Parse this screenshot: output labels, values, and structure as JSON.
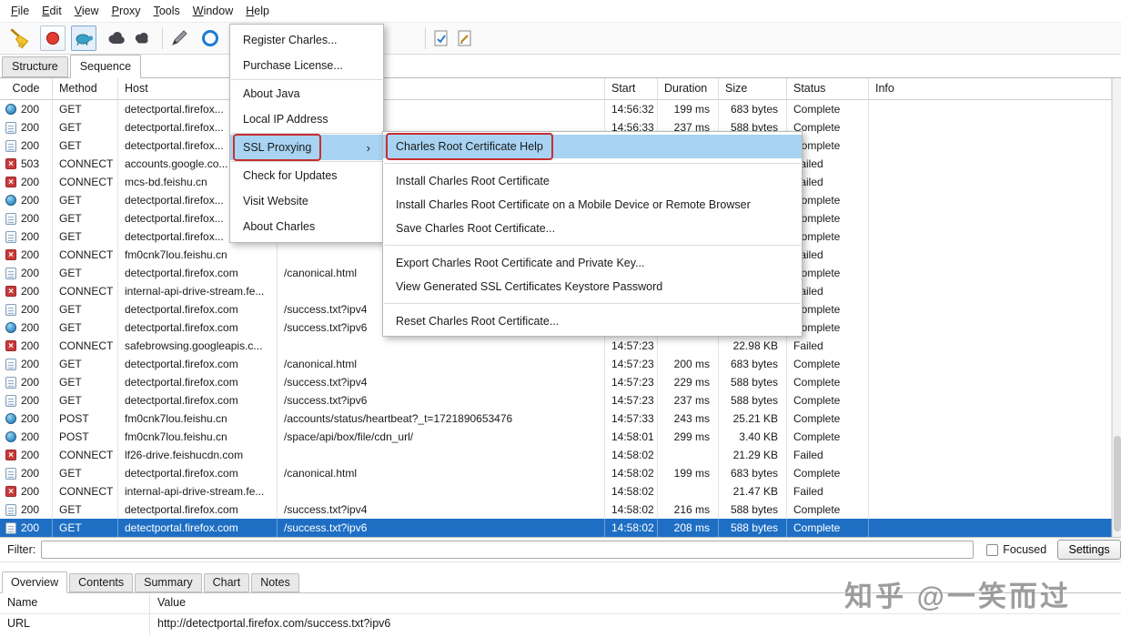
{
  "menubar": {
    "items": [
      {
        "name": "menubar-item-file",
        "label": "File"
      },
      {
        "name": "menubar-item-edit",
        "label": "Edit"
      },
      {
        "name": "menubar-item-view",
        "label": "View"
      },
      {
        "name": "menubar-item-proxy",
        "label": "Proxy"
      },
      {
        "name": "menubar-item-tools",
        "label": "Tools"
      },
      {
        "name": "menubar-item-window",
        "label": "Window"
      },
      {
        "name": "menubar-item-help",
        "label": "Help"
      }
    ]
  },
  "toolbar": {
    "icons": [
      "clear-broom-icon",
      "record-button",
      "throttle-turtle-button",
      "breakpoints-icon",
      "cloud-icon",
      "compose-pencil-icon",
      "repeat-circle-icon",
      "validate-check-icon",
      "edit-document-icon"
    ]
  },
  "view_tabs": {
    "items": [
      {
        "label": "Structure",
        "active": false
      },
      {
        "label": "Sequence",
        "active": true
      }
    ]
  },
  "table": {
    "columns": [
      "Code",
      "Method",
      "Host",
      "",
      "Start",
      "Duration",
      "Size",
      "Status",
      "Info"
    ],
    "rows": [
      {
        "icon": "orb",
        "code": "200",
        "method": "GET",
        "host": "detectportal.firefox...",
        "path": "",
        "start": "14:56:32",
        "duration": "199 ms",
        "size": "683 bytes",
        "status": "Complete",
        "info": ""
      },
      {
        "icon": "doc",
        "code": "200",
        "method": "GET",
        "host": "detectportal.firefox...",
        "path": "",
        "start": "14:56:33",
        "duration": "237 ms",
        "size": "588 bytes",
        "status": "Complete",
        "info": ""
      },
      {
        "icon": "doc",
        "code": "200",
        "method": "GET",
        "host": "detectportal.firefox...",
        "path": "",
        "start": "",
        "duration": "",
        "size": "",
        "status": "Complete",
        "info": ""
      },
      {
        "icon": "fail",
        "code": "503",
        "method": "CONNECT",
        "host": "accounts.google.co...",
        "path": "",
        "start": "",
        "duration": "",
        "size": "",
        "status": "Failed",
        "info": ""
      },
      {
        "icon": "fail",
        "code": "200",
        "method": "CONNECT",
        "host": "mcs-bd.feishu.cn",
        "path": "",
        "start": "",
        "duration": "",
        "size": "",
        "status": "Failed",
        "info": ""
      },
      {
        "icon": "orb",
        "code": "200",
        "method": "GET",
        "host": "detectportal.firefox...",
        "path": "",
        "start": "",
        "duration": "",
        "size": "",
        "status": "Complete",
        "info": ""
      },
      {
        "icon": "doc",
        "code": "200",
        "method": "GET",
        "host": "detectportal.firefox...",
        "path": "",
        "start": "",
        "duration": "",
        "size": "",
        "status": "Complete",
        "info": ""
      },
      {
        "icon": "doc",
        "code": "200",
        "method": "GET",
        "host": "detectportal.firefox...",
        "path": "",
        "start": "",
        "duration": "",
        "size": "",
        "status": "Complete",
        "info": ""
      },
      {
        "icon": "fail",
        "code": "200",
        "method": "CONNECT",
        "host": "fm0cnk7lou.feishu.cn",
        "path": "",
        "start": "",
        "duration": "",
        "size": "",
        "status": "Failed",
        "info": ""
      },
      {
        "icon": "doc",
        "code": "200",
        "method": "GET",
        "host": "detectportal.firefox.com",
        "path": "/canonical.html",
        "start": "",
        "duration": "",
        "size": "",
        "status": "Complete",
        "info": ""
      },
      {
        "icon": "fail",
        "code": "200",
        "method": "CONNECT",
        "host": "internal-api-drive-stream.fe...",
        "path": "",
        "start": "",
        "duration": "",
        "size": "",
        "status": "Failed",
        "info": ""
      },
      {
        "icon": "doc",
        "code": "200",
        "method": "GET",
        "host": "detectportal.firefox.com",
        "path": "/success.txt?ipv4",
        "start": "",
        "duration": "",
        "size": "",
        "status": "Complete",
        "info": ""
      },
      {
        "icon": "orb",
        "code": "200",
        "method": "GET",
        "host": "detectportal.firefox.com",
        "path": "/success.txt?ipv6",
        "start": "",
        "duration": "",
        "size": "",
        "status": "Complete",
        "info": ""
      },
      {
        "icon": "fail",
        "code": "200",
        "method": "CONNECT",
        "host": "safebrowsing.googleapis.c...",
        "path": "",
        "start": "14:57:23",
        "duration": "",
        "size": "22.98 KB",
        "status": "Failed",
        "info": ""
      },
      {
        "icon": "doc",
        "code": "200",
        "method": "GET",
        "host": "detectportal.firefox.com",
        "path": "/canonical.html",
        "start": "14:57:23",
        "duration": "200 ms",
        "size": "683 bytes",
        "status": "Complete",
        "info": ""
      },
      {
        "icon": "doc",
        "code": "200",
        "method": "GET",
        "host": "detectportal.firefox.com",
        "path": "/success.txt?ipv4",
        "start": "14:57:23",
        "duration": "229 ms",
        "size": "588 bytes",
        "status": "Complete",
        "info": ""
      },
      {
        "icon": "doc",
        "code": "200",
        "method": "GET",
        "host": "detectportal.firefox.com",
        "path": "/success.txt?ipv6",
        "start": "14:57:23",
        "duration": "237 ms",
        "size": "588 bytes",
        "status": "Complete",
        "info": ""
      },
      {
        "icon": "orb",
        "code": "200",
        "method": "POST",
        "host": "fm0cnk7lou.feishu.cn",
        "path": "/accounts/status/heartbeat?_t=1721890653476",
        "start": "14:57:33",
        "duration": "243 ms",
        "size": "25.21 KB",
        "status": "Complete",
        "info": ""
      },
      {
        "icon": "orb",
        "code": "200",
        "method": "POST",
        "host": "fm0cnk7lou.feishu.cn",
        "path": "/space/api/box/file/cdn_url/",
        "start": "14:58:01",
        "duration": "299 ms",
        "size": "3.40 KB",
        "status": "Complete",
        "info": ""
      },
      {
        "icon": "fail",
        "code": "200",
        "method": "CONNECT",
        "host": "lf26-drive.feishucdn.com",
        "path": "",
        "start": "14:58:02",
        "duration": "",
        "size": "21.29 KB",
        "status": "Failed",
        "info": ""
      },
      {
        "icon": "doc",
        "code": "200",
        "method": "GET",
        "host": "detectportal.firefox.com",
        "path": "/canonical.html",
        "start": "14:58:02",
        "duration": "199 ms",
        "size": "683 bytes",
        "status": "Complete",
        "info": ""
      },
      {
        "icon": "fail",
        "code": "200",
        "method": "CONNECT",
        "host": "internal-api-drive-stream.fe...",
        "path": "",
        "start": "14:58:02",
        "duration": "",
        "size": "21.47 KB",
        "status": "Failed",
        "info": ""
      },
      {
        "icon": "doc",
        "code": "200",
        "method": "GET",
        "host": "detectportal.firefox.com",
        "path": "/success.txt?ipv4",
        "start": "14:58:02",
        "duration": "216 ms",
        "size": "588 bytes",
        "status": "Complete",
        "info": ""
      },
      {
        "icon": "doc",
        "code": "200",
        "method": "GET",
        "host": "detectportal.firefox.com",
        "path": "/success.txt?ipv6",
        "start": "14:58:02",
        "duration": "208 ms",
        "size": "588 bytes",
        "status": "Complete",
        "info": "",
        "selected": true
      }
    ]
  },
  "filter": {
    "label": "Filter:",
    "value": "",
    "focused_label": "Focused",
    "focused_checked": false,
    "settings_label": "Settings"
  },
  "bottom_tabs": {
    "items": [
      {
        "label": "Overview",
        "active": true
      },
      {
        "label": "Contents",
        "active": false
      },
      {
        "label": "Summary",
        "active": false
      },
      {
        "label": "Chart",
        "active": false
      },
      {
        "label": "Notes",
        "active": false
      }
    ]
  },
  "detail": {
    "columns": [
      "Name",
      "Value"
    ],
    "rows": [
      {
        "name": "URL",
        "value": "http://detectportal.firefox.com/success.txt?ipv6"
      }
    ]
  },
  "help_menu": {
    "items": [
      {
        "name": "menu-item-register-charles",
        "label": "Register Charles..."
      },
      {
        "name": "menu-item-purchase-license",
        "label": "Purchase License..."
      },
      {
        "type": "separator"
      },
      {
        "name": "menu-item-about-java",
        "label": "About Java"
      },
      {
        "name": "menu-item-local-ip-address",
        "label": "Local IP Address"
      },
      {
        "type": "separator"
      },
      {
        "name": "menu-item-ssl-proxying",
        "label": "SSL Proxying",
        "highlighted": true,
        "annotated": true,
        "submenu": true
      },
      {
        "type": "separator"
      },
      {
        "name": "menu-item-check-for-updates",
        "label": "Check for Updates"
      },
      {
        "name": "menu-item-visit-website",
        "label": "Visit Website"
      },
      {
        "name": "menu-item-about-charles",
        "label": "About Charles"
      }
    ]
  },
  "ssl_submenu": {
    "items": [
      {
        "name": "menu-item-root-cert-help",
        "label": "Charles Root Certificate Help",
        "highlighted": true,
        "annotated": true
      },
      {
        "type": "separator"
      },
      {
        "name": "menu-item-install-root-cert",
        "label": "Install Charles Root Certificate"
      },
      {
        "name": "menu-item-install-root-cert-mobile",
        "label": "Install Charles Root Certificate on a Mobile Device or Remote Browser"
      },
      {
        "name": "menu-item-save-root-cert",
        "label": "Save Charles Root Certificate..."
      },
      {
        "type": "separator"
      },
      {
        "name": "menu-item-export-root-cert",
        "label": "Export Charles Root Certificate and Private Key..."
      },
      {
        "name": "menu-item-view-keystore-password",
        "label": "View Generated SSL Certificates Keystore Password"
      },
      {
        "type": "separator"
      },
      {
        "name": "menu-item-reset-root-cert",
        "label": "Reset Charles Root Certificate..."
      }
    ]
  },
  "watermark": {
    "text": "知乎 @一笑而过"
  },
  "colors": {
    "selection_blue": "#1e6fc4",
    "menu_highlight": "#a8d3f2",
    "annotation_red": "#c62f2f",
    "failed_icon": "#c93b3b"
  }
}
